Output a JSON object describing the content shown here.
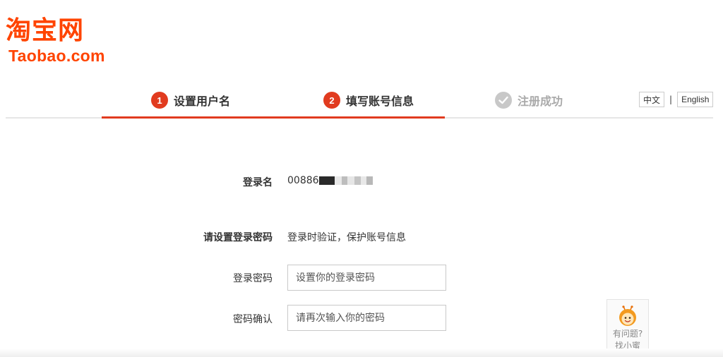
{
  "logo": {
    "cn": "淘宝网",
    "en": "Taobao.com",
    "color": "#ff4400"
  },
  "steps": [
    {
      "number": "1",
      "label": "设置用户名"
    },
    {
      "number": "2",
      "label": "填写账号信息"
    },
    {
      "label": "注册成功"
    }
  ],
  "colors": {
    "accent": "#e13b1f",
    "inactive": "#c8c8c8"
  },
  "language": {
    "zh": "中文",
    "separator": "|",
    "en": "English"
  },
  "form": {
    "login_name_label": "登录名",
    "login_name_value": "00886",
    "set_password_label": "请设置登录密码",
    "set_password_hint": "登录时验证，保护账号信息",
    "password_label": "登录密码",
    "password_placeholder": "设置你的登录密码",
    "confirm_label": "密码确认",
    "confirm_placeholder": "请再次输入你的密码"
  },
  "help": {
    "line1": "有问题?",
    "line2": "找小蜜",
    "icon": "bee-mascot-icon"
  }
}
